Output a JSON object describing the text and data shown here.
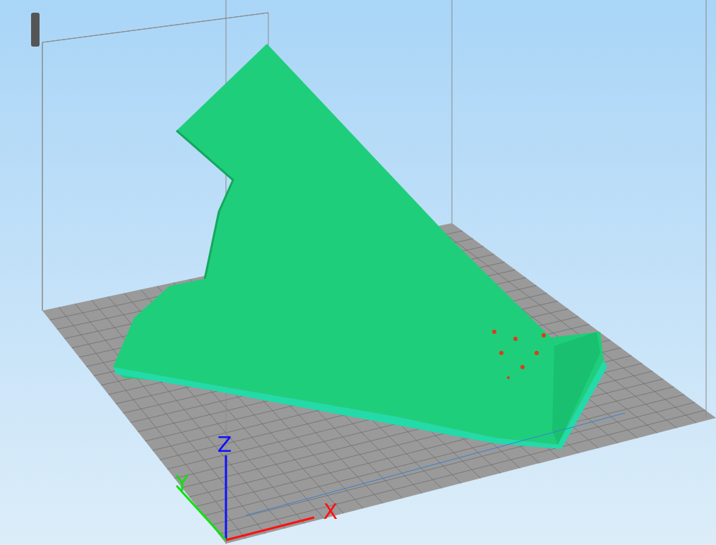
{
  "viewport": {
    "axes": [
      {
        "kind": "z",
        "label": "Z",
        "color": "#1010ff"
      },
      {
        "kind": "y",
        "label": "Y",
        "color": "#10e010"
      },
      {
        "kind": "x",
        "label": "X",
        "color": "#ff1010"
      }
    ]
  }
}
